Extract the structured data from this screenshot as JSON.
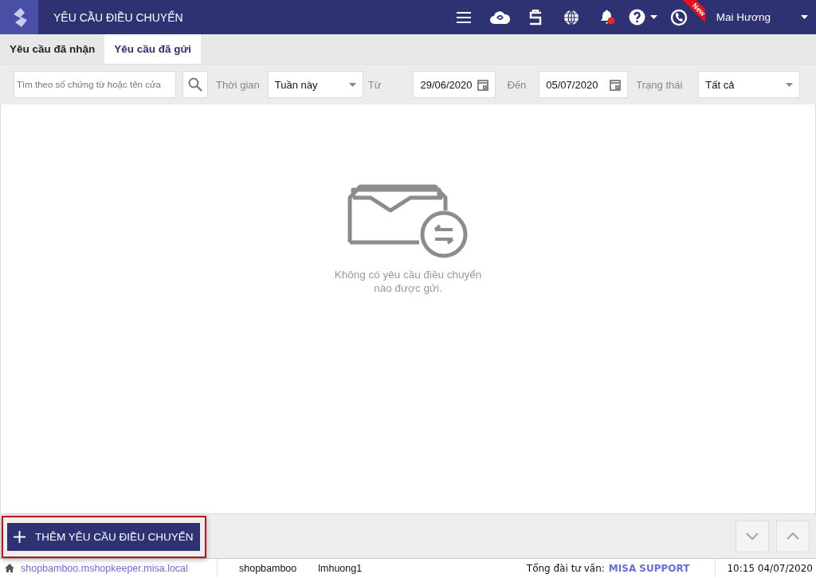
{
  "header": {
    "title": "YÊU CẦU ĐIỀU CHUYỂN",
    "notification_dot": true,
    "new_badge": "New",
    "user": "Mai Hương"
  },
  "tabs": [
    {
      "label": "Yêu cầu đã nhận",
      "selected": false
    },
    {
      "label": "Yêu cầu đã gửi",
      "selected": true
    }
  ],
  "filters": {
    "search": {
      "placeholder": "Tìm theo số chứng từ hoặc tên cửa"
    },
    "time_label": "Thời gian",
    "time_value": "Tuần này",
    "from_label": "Từ",
    "from_date": "29/06/2020",
    "to_label": "Đến",
    "to_date": "05/07/2020",
    "status_label": "Trạng thái",
    "status_value": "Tất cả"
  },
  "empty_message": "Không có yêu cầu điều chuyển nào được gửi.",
  "add_button": {
    "label": "THÊM YÊU CẦU ĐIỀU CHUYỂN",
    "highlighted": true
  },
  "status_bar": {
    "domain": "shopbamboo.mshopkeeper.misa.local",
    "shop": "shopbamboo",
    "user": "lmhuong1",
    "hotline_label": "Tổng đài tư vấn:",
    "hotline": "MISA SUPPORT",
    "datetime": "10:15 04/07/2020"
  }
}
